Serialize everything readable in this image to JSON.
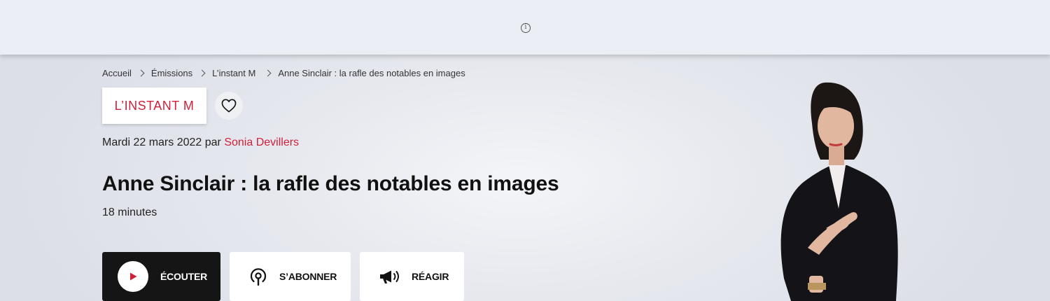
{
  "ad_banner": {
    "info_icon": "info-icon"
  },
  "breadcrumb": {
    "items": [
      {
        "label": "Accueil"
      },
      {
        "label": "Émissions"
      },
      {
        "label": "L’instant M"
      },
      {
        "label": "Anne Sinclair : la rafle des notables en images"
      }
    ],
    "separator_icon": "chevron-right-icon"
  },
  "show": {
    "tag_label": "L’INSTANT M",
    "favorite_icon": "heart-icon"
  },
  "episode": {
    "date": "Mardi 22 mars 2022",
    "by": "par",
    "author": "Sonia Devillers",
    "title": "Anne Sinclair : la rafle des notables en images",
    "duration": "18 minutes"
  },
  "actions": {
    "listen_label": "Écouter",
    "subscribe_label": "S’abonner",
    "react_label": "Réagir"
  },
  "colors": {
    "accent": "#d0213a",
    "dark_button": "#151515"
  }
}
